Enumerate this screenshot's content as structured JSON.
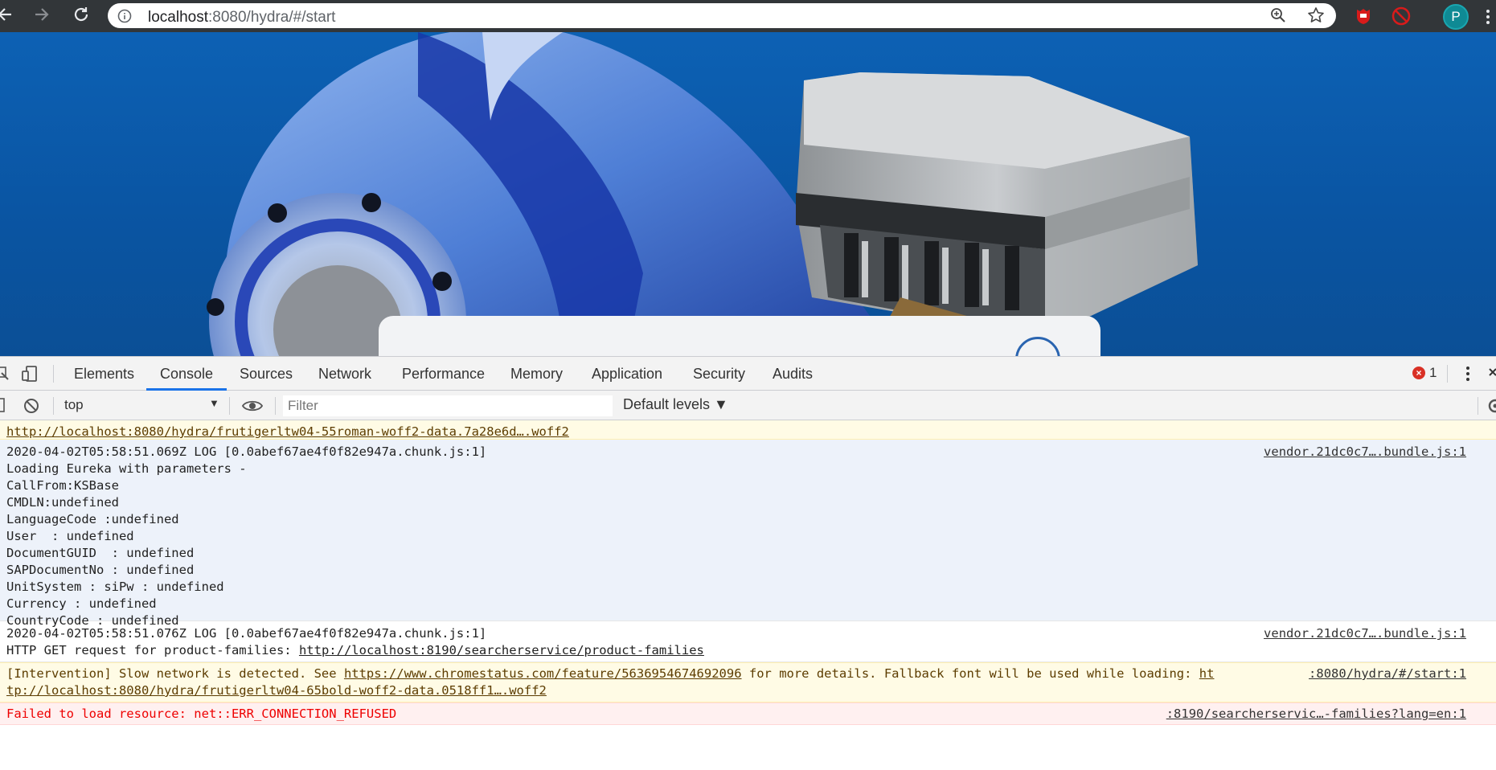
{
  "browser": {
    "url_host": "localhost",
    "url_rest": ":8080/hydra/#/start",
    "avatar_initial": "P",
    "icons": [
      "back-icon",
      "forward-icon",
      "reload-icon",
      "info-icon",
      "zoom-icon",
      "star-icon",
      "shield-extension-icon",
      "block-extension-icon",
      "chrome-menu-icon"
    ]
  },
  "devtools": {
    "tabs": [
      {
        "label": "Elements"
      },
      {
        "label": "Console"
      },
      {
        "label": "Sources"
      },
      {
        "label": "Network"
      },
      {
        "label": "Performance"
      },
      {
        "label": "Memory"
      },
      {
        "label": "Application"
      },
      {
        "label": "Security"
      },
      {
        "label": "Audits"
      }
    ],
    "active_tab": "Console",
    "error_count": "1",
    "context": "top",
    "filter_placeholder": "Filter",
    "levels_label": "Default levels ▼"
  },
  "console": {
    "msg0_link": "http://localhost:8080/hydra/frutigerltw04-55roman-woff2-data.7a28e6d….woff2",
    "msg1": {
      "meta": "2020-04-02T05:58:51.069Z LOG [0.0abef67ae4f0f82e947a.chunk.js:1]",
      "source": "vendor.21dc0c7….bundle.js:1",
      "lines": [
        "Loading Eureka with parameters -",
        "CallFrom:KSBase",
        "CMDLN:undefined",
        "LanguageCode :undefined",
        "User  : undefined",
        "DocumentGUID  : undefined",
        "SAPDocumentNo : undefined",
        "UnitSystem : siPw : undefined",
        "Currency : undefined",
        "CountryCode : undefined"
      ]
    },
    "msg2": {
      "meta": "2020-04-02T05:58:51.076Z LOG [0.0abef67ae4f0f82e947a.chunk.js:1]",
      "source": "vendor.21dc0c7….bundle.js:1",
      "text": "HTTP GET request for product-families: ",
      "link": "http://localhost:8190/searcherservice/product-families"
    },
    "msg3": {
      "prefix": "[Intervention] Slow network is detected. See ",
      "link": "https://www.chromestatus.com/feature/5636954674692096",
      "middle": " for more details. Fallback font will be used while loading: ",
      "link_start": "ht",
      "link_cont": "tp://localhost:8080/hydra/frutigerltw04-65bold-woff2-data.0518ff1….woff2",
      "source": ":8080/hydra/#/start:1"
    },
    "msg4": {
      "text": "Failed to load resource: net::ERR_CONNECTION_REFUSED",
      "source": ":8190/searcherservic…-families?lang=en:1"
    }
  },
  "colors": {
    "toolbar": "#323639",
    "page_blue": "#0d61b4",
    "tab_underline": "#1a73e8",
    "error_red": "#d93025",
    "warning_bg": "#fffbe5",
    "error_bg": "#fff0f0"
  }
}
